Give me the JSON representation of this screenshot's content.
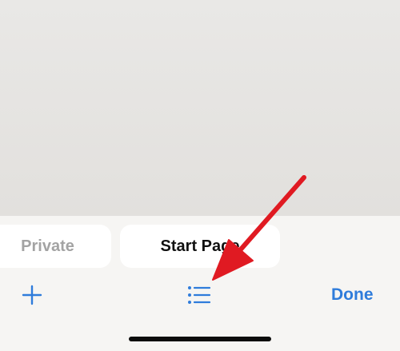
{
  "tabs": [
    {
      "label": "Private",
      "state": "inactive"
    },
    {
      "label": "Start Page",
      "state": "active"
    }
  ],
  "toolbar": {
    "new_tab_icon": "plus-icon",
    "tab_overview_icon": "list-icon",
    "done_label": "Done"
  },
  "colors": {
    "accent": "#2f7cdb",
    "annotation_arrow": "#e01a22",
    "panel_background": "#f6f5f3",
    "content_background": "#e5e3e0"
  },
  "annotation": {
    "type": "arrow",
    "points_to": "tab-overview-button"
  }
}
